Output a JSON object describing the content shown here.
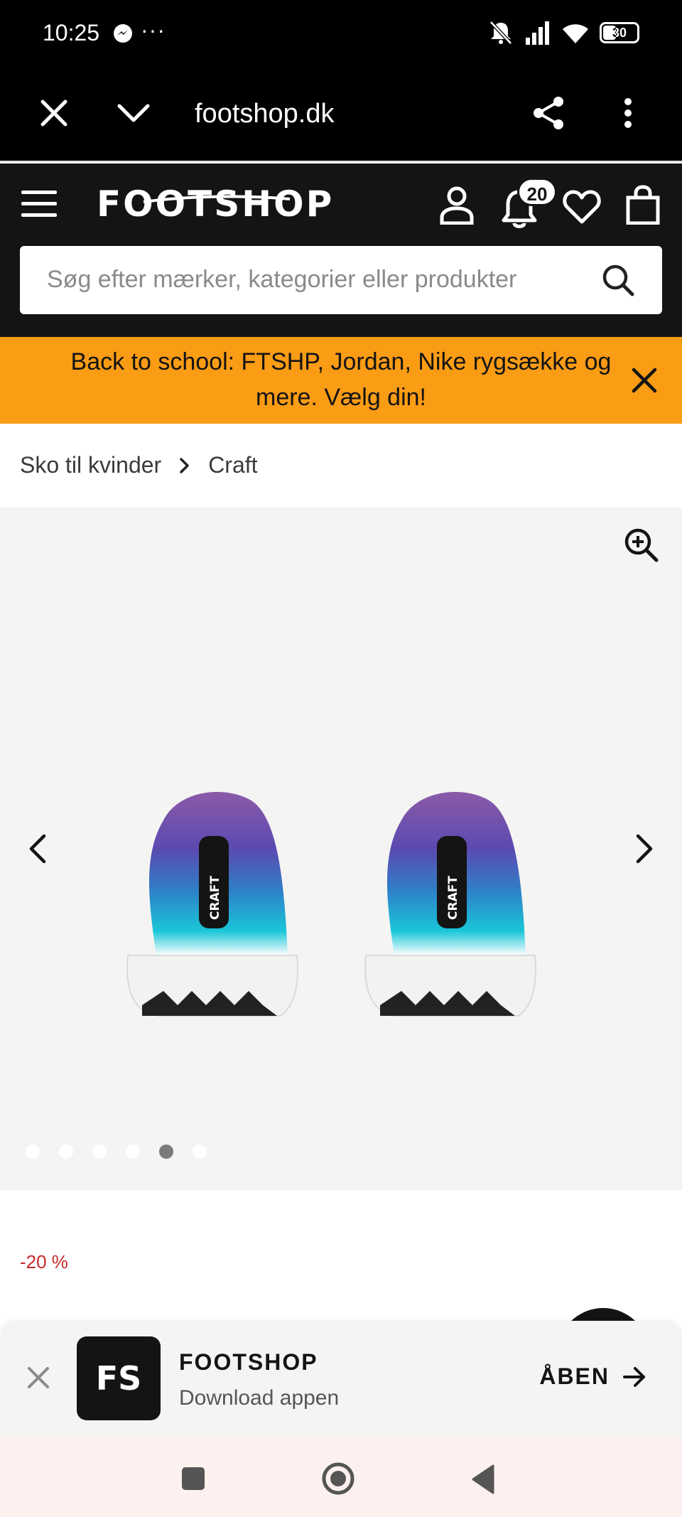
{
  "status_bar": {
    "time": "10:25",
    "dots": "···",
    "battery": "30"
  },
  "browser": {
    "url": "footshop.dk"
  },
  "header": {
    "logo": "FOOTSHOP",
    "notification_count": "20",
    "search_placeholder": "Søg efter mærker, kategorier eller produkter"
  },
  "promo": {
    "text": "Back to school: FTSHP, Jordan, Nike rygsække og mere. Vælg din!",
    "color": "#fb9c15"
  },
  "breadcrumb": {
    "items": [
      "Sko til kvinder",
      "Craft"
    ]
  },
  "gallery": {
    "brand_mark": "CRAFT",
    "image_count": 6,
    "active_index": 4
  },
  "product": {
    "discount": "-20 %"
  },
  "app_banner": {
    "title": "FOOTSHOP",
    "subtitle": "Download appen",
    "icon_text": "FS",
    "open_label": "ÅBEN"
  }
}
